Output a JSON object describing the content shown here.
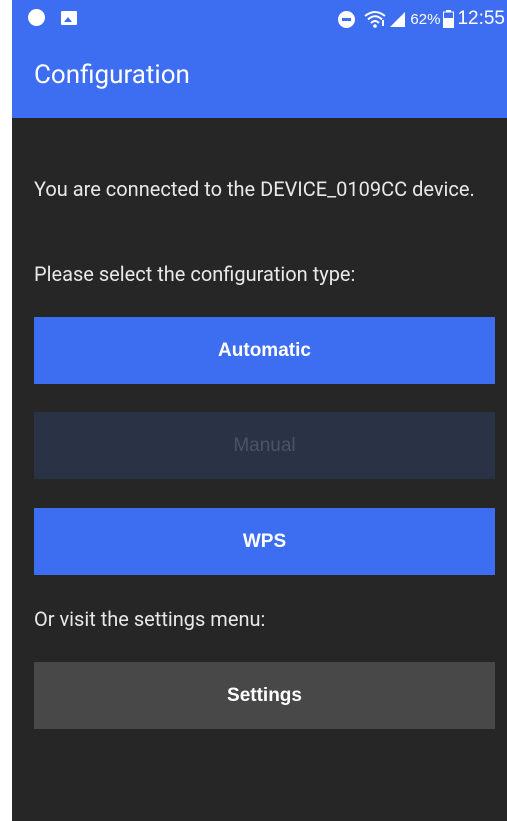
{
  "status_bar": {
    "battery_percent": "62%",
    "time": "12:55",
    "left_icons": [
      "notification-dot-icon",
      "image-icon"
    ],
    "right_icons": [
      "do-not-disturb-icon",
      "wifi-icon",
      "signal-icon",
      "battery-icon"
    ]
  },
  "app_bar": {
    "title": "Configuration"
  },
  "main": {
    "connected_message": "You are connected to the DEVICE_0109CC device.",
    "select_prompt": "Please select the configuration type:",
    "buttons": {
      "automatic": "Automatic",
      "manual": "Manual",
      "wps": "WPS"
    },
    "settings_prompt": "Or visit the settings menu:",
    "settings_button": "Settings"
  },
  "colors": {
    "accent": "#3d6df0",
    "background": "#262626",
    "disabled_button": "#2a3246",
    "settings_button": "#484848"
  }
}
